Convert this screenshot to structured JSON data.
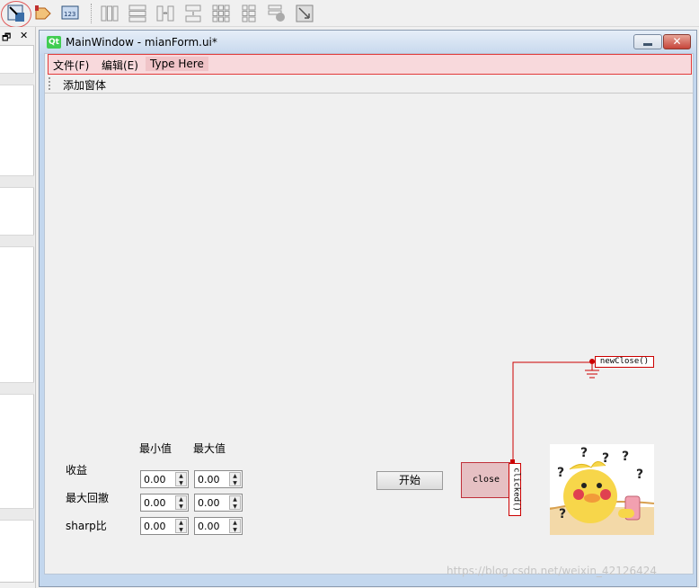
{
  "toolbar": {
    "icons": [
      "edit-widgets-icon",
      "edit-signals-slots-icon",
      "edit-tab-order-icon",
      "layout-horizontal-icon",
      "layout-vertical-icon",
      "layout-horizontal-splitter-icon",
      "layout-vertical-splitter-icon",
      "layout-grid-icon",
      "layout-form-icon",
      "break-layout-icon",
      "adjust-size-icon"
    ]
  },
  "left_dock": {
    "float_label": "🗗",
    "close_label": "✕"
  },
  "window": {
    "title": "MainWindow - mianForm.ui*",
    "logo_text": "Qt",
    "close_label": "✕"
  },
  "menubar": {
    "items": [
      "文件(F)",
      "编辑(E)"
    ],
    "type_here": "Type Here"
  },
  "toolbar2": {
    "add_window": "添加窗体"
  },
  "form": {
    "col_min": "最小值",
    "col_max": "最大值",
    "rows": [
      {
        "label": "收益",
        "min": "0.00",
        "max": "0.00"
      },
      {
        "label": "最大回撤",
        "min": "0.00",
        "max": "0.00"
      },
      {
        "label": "sharp比",
        "min": "0.00",
        "max": "0.00"
      }
    ],
    "start_button": "开始",
    "close_button": "close",
    "signal": "clicked()",
    "slot": "newClose()"
  },
  "watermark": "https://blog.csdn.net/weixin_42126424",
  "colors": {
    "connection": "#cc0000",
    "menubar_bg": "#f8d9dc",
    "menubar_border": "#e23a3a",
    "qt_green": "#41cd52"
  }
}
